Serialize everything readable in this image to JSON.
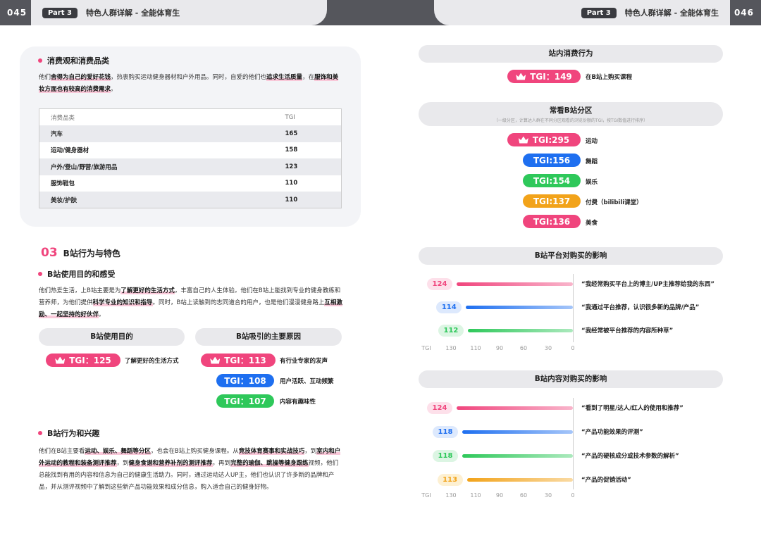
{
  "header": {
    "page_left": "045",
    "page_right": "046",
    "part": "Part 3",
    "title": "特色人群详解 - 全能体育生"
  },
  "consumption": {
    "heading": "消费观和消费品类",
    "para_html": "他们<b>舍得为自己的爱好花钱</b>，热衷购买运动健身器材和户外用品。同时，自爱的他们也<b>追求生活质量</b>，在<b>服饰和美妆方面也有较高的消费需求</b>。",
    "table": {
      "col1": "消费品类",
      "col2": "TGI",
      "rows": [
        [
          "汽车",
          "165"
        ],
        [
          "运动/健身器材",
          "158"
        ],
        [
          "户外/登山/野营/旅游用品",
          "123"
        ],
        [
          "服饰鞋包",
          "110"
        ],
        [
          "美妆/护肤",
          "110"
        ]
      ]
    }
  },
  "section03": {
    "num": "03",
    "title": "B站行为与特色"
  },
  "purpose": {
    "heading": "B站使用目的和感受",
    "para_html": "他们热爱生活，上B站主要是为<b>了解更好的生活方式</b>，丰富自己的人生体验。他们在B站上能找到专业的健身教练和营养师，为他们提供<b>科学专业的知识和指导</b>。同时，B站上读触到的志同道合的用户，也是他们漫漫健身路上<b>互相激励、一起坚持的好伙伴</b>。",
    "pill1": "B站使用目的",
    "pill2": "B站吸引的主要原因",
    "left": [
      {
        "tgi": "TGI：125",
        "label": "了解更好的生活方式",
        "color": "pink"
      }
    ],
    "right": [
      {
        "tgi": "TGI：113",
        "label": "有行业专家的发声",
        "color": "pink",
        "crown": true
      },
      {
        "tgi": "TGI：108",
        "label": "用户活跃、互动频繁",
        "color": "blue"
      },
      {
        "tgi": "TGI：107",
        "label": "内容有趣味性",
        "color": "green"
      }
    ]
  },
  "interest": {
    "heading": "B站行为和兴趣",
    "para_html": "他们在B站主要看<b>运动、娱乐、舞蹈等分区</b>，也会在B站上购买健身课程。从<b>竞技体育赛事和实战技巧</b>，到<b>室内和户外运动的教程和装备测评推荐</b>，到<b>健身食谱和营养补剂的测评推荐</b>，再到<b>完整的瑜伽、跳操等健身跟练</b>视频，他们总能找到有用的内容和信息为自己的健康生活助力。同时，通过运动达人UP主，他们也认识了许多新的品牌和产品，并从测评视频中了解到这些新产品功能效果和成分信息，购入适合自己的健身好物。"
  },
  "right_page": {
    "buy_header": "站内消费行为",
    "buy": {
      "tgi": "TGI：149",
      "label": "在B站上购买课程"
    },
    "zones_header": "常看B站分区",
    "zones_sub": "（一级分区，计算达人群在不同分区观看的浏览份额的TGI，按TGI数值进行排序）",
    "zones": [
      {
        "tgi": "TGI:295",
        "label": "运动",
        "color": "pink"
      },
      {
        "tgi": "TGI:156",
        "label": "舞蹈",
        "color": "blue"
      },
      {
        "tgi": "TGI:154",
        "label": "娱乐",
        "color": "green"
      },
      {
        "tgi": "TGI:137",
        "label": "付费（bilibili课堂）",
        "color": "orange"
      },
      {
        "tgi": "TGI:136",
        "label": "美食",
        "color": "pink"
      }
    ],
    "platform_header": "B站平台对购买的影响",
    "content_header": "B站内容对购买的影响",
    "axis_ticks": [
      "TGI",
      "130",
      "110",
      "90",
      "60",
      "30",
      "0"
    ]
  },
  "chart_data": [
    {
      "type": "bar",
      "title": "B站平台对购买的影响",
      "xlabel": "TGI",
      "xlim": [
        0,
        130
      ],
      "categories": [
        "“我经常购买平台上的博主/UP主推荐给我的东西”",
        "“我通过平台推荐，认识很多新的品牌/产品”",
        "“我经常被平台推荐的内容所种草”"
      ],
      "values": [
        124,
        114,
        112
      ],
      "colors": [
        "#f0457d",
        "#1e6ff0",
        "#2ec85a"
      ]
    },
    {
      "type": "bar",
      "title": "B站内容对购买的影响",
      "xlabel": "TGI",
      "xlim": [
        0,
        130
      ],
      "categories": [
        "“看到了明星/达人/红人的使用和推荐”",
        "“产品功能效果的评测”",
        "“产品的硬核成分或技术参数的解析”",
        "“产品的促销活动”"
      ],
      "values": [
        124,
        118,
        118,
        113
      ],
      "colors": [
        "#f0457d",
        "#1e6ff0",
        "#2ec85a",
        "#f2a31a"
      ]
    }
  ]
}
